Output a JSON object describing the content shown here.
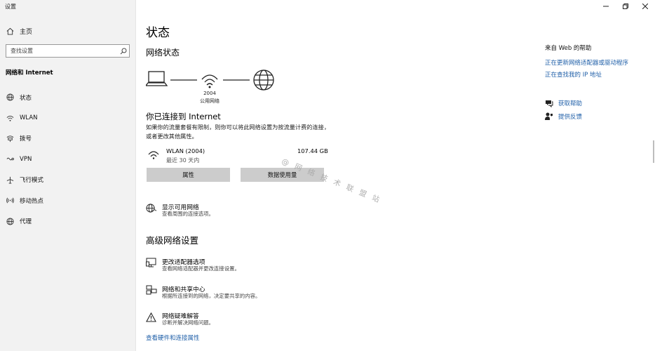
{
  "app": {
    "title": "设置"
  },
  "window_controls": {
    "minimize": "–",
    "maximize": "☐",
    "close": "✕"
  },
  "sidebar": {
    "home_label": "主页",
    "search_placeholder": "查找设置",
    "section_title": "网络和 Internet",
    "items": [
      {
        "label": "状态",
        "icon": "globe-icon"
      },
      {
        "label": "WLAN",
        "icon": "wifi-icon"
      },
      {
        "label": "拨号",
        "icon": "dialup-icon"
      },
      {
        "label": "VPN",
        "icon": "vpn-icon"
      },
      {
        "label": "飞行模式",
        "icon": "airplane-icon"
      },
      {
        "label": "移动热点",
        "icon": "hotspot-icon"
      },
      {
        "label": "代理",
        "icon": "proxy-globe-icon"
      }
    ]
  },
  "main": {
    "page_title": "状态",
    "network_status_title": "网络状态",
    "network_name": "2004",
    "network_type": "公用网络",
    "connected_title": "你已连接到 Internet",
    "connected_desc": "如果你的流量套餐有限制，则你可以将此网络设置为按流量计费的连接，或者更改其他属性。",
    "connection": {
      "name": "WLAN (2004)",
      "time": "最近 30 天内",
      "usage": "107.44 GB"
    },
    "buttons": {
      "properties": "属性",
      "data_usage": "数据使用量"
    },
    "watermark": "@ 网 络 技 术 联 盟 站",
    "show_networks": {
      "title": "显示可用网络",
      "desc": "查看周围的连接选项。"
    },
    "advanced_title": "高级网络设置",
    "advanced_items": [
      {
        "title": "更改适配器选项",
        "desc": "查看网络适配器并更改连接设置。",
        "icon": "adapter-icon"
      },
      {
        "title": "网络和共享中心",
        "desc": "根据所连接到的网络，决定要共享的内容。",
        "icon": "sharing-center-icon"
      },
      {
        "title": "网络疑难解答",
        "desc": "诊断并解决网络问题。",
        "icon": "warning-icon"
      }
    ],
    "hardware_link": "查看硬件和连接属性"
  },
  "right": {
    "help_title": "来自 Web 的帮助",
    "links": [
      "正在更新网络适配器或驱动程序",
      "正在查找我的 IP 地址"
    ],
    "get_help": "获取帮助",
    "feedback": "提供反馈"
  }
}
